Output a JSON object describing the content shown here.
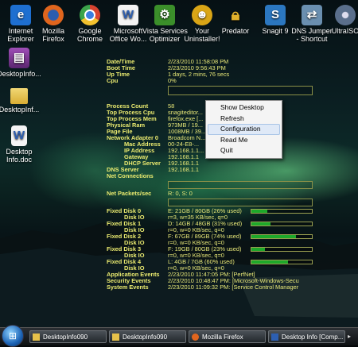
{
  "desktop_icons": [
    {
      "name": "internet-explorer-icon",
      "label": [
        "Internet",
        "Explorer"
      ],
      "glyph": "e",
      "color": "#1e6fd0"
    },
    {
      "name": "firefox-icon",
      "label": [
        "Mozilla",
        "Firefox"
      ],
      "glyph": "●",
      "color": "#e0651d"
    },
    {
      "name": "chrome-icon",
      "label": [
        "Google",
        "Chrome"
      ],
      "glyph": "◉",
      "color": "#d8432f"
    },
    {
      "name": "office-icon",
      "label": [
        "Microsoft",
        "Office Wo..."
      ],
      "glyph": "W",
      "color": "#2d5fb1"
    },
    {
      "name": "vista-optimizer-icon",
      "label": [
        "Vista Services",
        "Optimizer"
      ],
      "glyph": "⚙",
      "color": "#3b8f2a"
    },
    {
      "name": "uninstaller-icon",
      "label": [
        "Your",
        "Uninstaller!"
      ],
      "glyph": "☻",
      "color": "#d9a516"
    },
    {
      "name": "predator-icon",
      "label": [
        "Predator",
        ""
      ],
      "glyph": "🔒",
      "color": "#e3b22b"
    },
    {
      "name": "snagit-icon",
      "label": [
        "Snagit 9",
        ""
      ],
      "glyph": "S",
      "color": "#2b77c0"
    },
    {
      "name": "dns-jumper-icon",
      "label": [
        "DNS Jumper",
        "- Shortcut"
      ],
      "glyph": "⇄",
      "color": "#6a8fb0"
    },
    {
      "name": "ultrasoft-icon",
      "label": [
        "UltraISO",
        ""
      ],
      "glyph": "◎",
      "color": "#5a6f8c"
    }
  ],
  "left_icons": [
    {
      "name": "desktopinfo-archive-icon",
      "label": "DesktopInfo...",
      "glyph": "▤",
      "color": "#7b3b8f"
    },
    {
      "name": "desktopinfo-folder-icon",
      "label": "DesktopInf...",
      "glyph": "",
      "color": "#e8c24a"
    },
    {
      "name": "desktopinfo-doc-icon",
      "label": [
        "Desktop",
        "Info.doc"
      ],
      "glyph": "W",
      "color": "#f4f4f4"
    }
  ],
  "info": {
    "datetime": {
      "key": "Date/Time",
      "value": "2/23/2010 11:58:08 PM"
    },
    "boot_time": {
      "key": "Boot Time",
      "value": "2/23/2010 9:56:43 PM"
    },
    "up_time": {
      "key": "Up Time",
      "value": "1 days, 2 mins, 76 secs"
    },
    "cpu": {
      "key": "Cpu",
      "value": "0%"
    },
    "process_count": {
      "key": "Process Count",
      "value": "58"
    },
    "top_cpu": {
      "key": "Top Process Cpu",
      "value": "snagiteditor..."
    },
    "top_mem": {
      "key": "Top Process Mem",
      "value": "firefox.exe [..."
    },
    "physical_ram": {
      "key": "Physical Ram",
      "value": "973MB / 19..."
    },
    "page_file": {
      "key": "Page File",
      "value": "1008MB / 39..."
    },
    "network_adapter": {
      "key": "Network Adapter 0",
      "value": "Broadcom N..."
    },
    "mac": {
      "key": "Mac Address",
      "value": "00-24-E8-..."
    },
    "ip": {
      "key": "IP Address",
      "value": "192.168.1.1..."
    },
    "gateway": {
      "key": "Gateway",
      "value": "192.168.1.1"
    },
    "dhcp": {
      "key": "DHCP Server",
      "value": "192.168.1.1"
    },
    "dns": {
      "key": "DNS Server",
      "value": "192.168.1.1"
    },
    "net_conn": {
      "key": "Net Connections",
      "value": ""
    },
    "net_packets": {
      "key": "Net Packets/sec",
      "value": "R: 0, S: 0"
    },
    "disks": [
      {
        "key": "Fixed Disk 0",
        "value": "E: 21GB / 80GB (26% used)",
        "fill": 0.26,
        "io": "r=3, w=35 KB/sec, q=0"
      },
      {
        "key": "Fixed Disk 1",
        "value": "D: 14GB / 48GB (31% used)",
        "fill": 0.31,
        "io": "r=0, w=0 KB/sec, q=0"
      },
      {
        "key": "Fixed Disk 2",
        "value": "F: 67GB / 89GB (74% used)",
        "fill": 0.74,
        "io": "r=0, w=0 KB/sec, q=0"
      },
      {
        "key": "Fixed Disk 3",
        "value": "F: 19GB / 80GB (23% used)",
        "fill": 0.23,
        "io": "r=0, w=0 KB/sec, q=0"
      },
      {
        "key": "Fixed Disk 4",
        "value": "L: 4GB / 7GB (60% used)",
        "fill": 0.6,
        "io": "r=0, w=0 KB/sec, q=0"
      }
    ],
    "disk_io_key": "Disk IO",
    "app_events": {
      "key": "Application Events",
      "value": "2/23/2010 11:47:05 PM: [PerfNet]"
    },
    "sec_events": {
      "key": "Security Events",
      "value": "2/23/2010 10:48:47 PM: [Microsoft-Windows-Secu"
    },
    "sys_events": {
      "key": "System Events",
      "value": "2/23/2010 11:09:32 PM: [Service Control Manager"
    }
  },
  "context_menu": {
    "items": [
      "Show Desktop",
      "Refresh",
      "Configuration",
      "Read Me",
      "Quit"
    ],
    "highlighted": "Configuration"
  },
  "taskbar": {
    "buttons": [
      {
        "label": "DesktopInfo090",
        "color": "#e6c14a"
      },
      {
        "label": "DesktopInfo090",
        "color": "#e6c14a"
      },
      {
        "label": "Mozilla Firefox",
        "color": "#e0651d"
      },
      {
        "label": "Desktop Info [Comp...",
        "color": "#2d5fb1"
      }
    ]
  }
}
